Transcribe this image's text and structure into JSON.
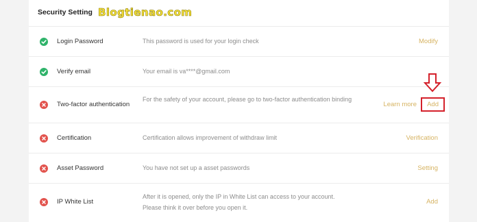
{
  "header": {
    "title": "Security Setting",
    "watermark": "Blogtienao.com"
  },
  "rows": [
    {
      "label": "Login Password",
      "status": "ok",
      "description": "This password is used for your login check",
      "action": "Modify"
    },
    {
      "label": "Verify email",
      "status": "ok",
      "description": "Your email is va****@gmail.com",
      "action": ""
    },
    {
      "label": "Two-factor authentication",
      "status": "error",
      "description": "For the safety of your account, please go to two-factor authentication binding",
      "action_secondary": "Learn more",
      "action": "Add"
    },
    {
      "label": "Certification",
      "status": "error",
      "description": "Certification allows improvement of withdraw limit",
      "action": "Verification"
    },
    {
      "label": "Asset Password",
      "status": "error",
      "description": "You have not set up a asset passwords",
      "action": "Setting"
    },
    {
      "label": "IP White List",
      "status": "error",
      "description": "After it is opened, only the IP in White List can access to your account. Please think it over before you open it.",
      "action": "Add"
    }
  ],
  "colors": {
    "ok": "#2fb36a",
    "error": "#e2534d",
    "action": "#d6b362",
    "highlight": "#d4202a"
  },
  "icons": {
    "ok": "check-circle-icon",
    "error": "x-circle-icon",
    "annotation": "down-arrow-icon"
  }
}
